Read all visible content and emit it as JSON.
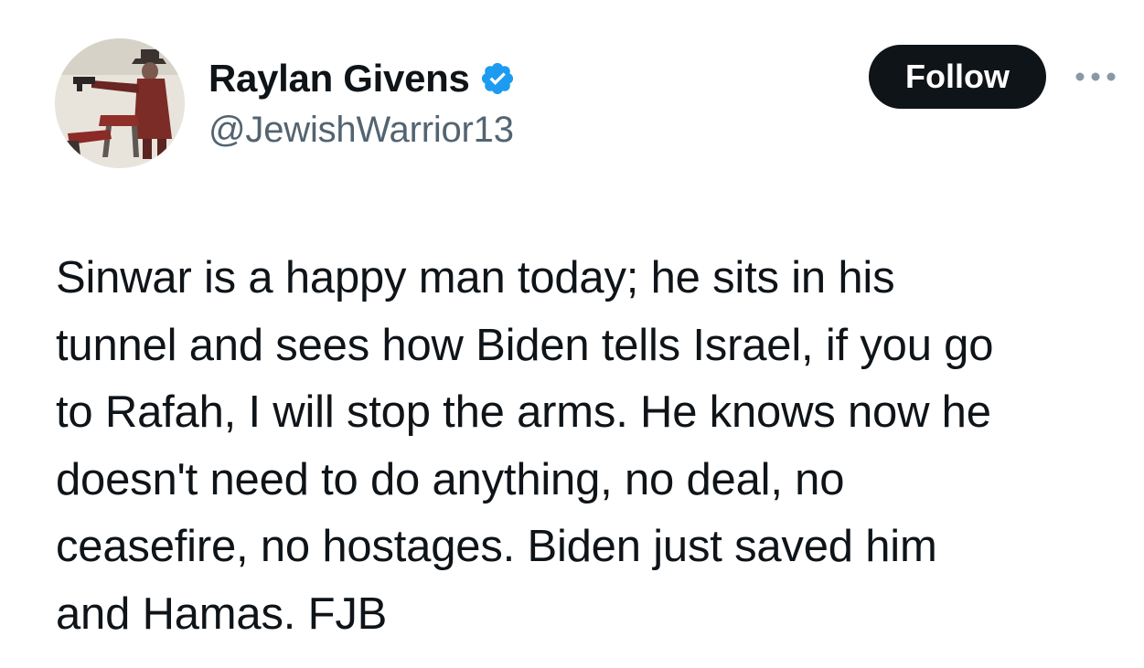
{
  "user": {
    "display_name": "Raylan Givens",
    "handle": "@JewishWarrior13",
    "verified": true,
    "avatar_icon": "western-gunman-avatar",
    "verified_icon": "verified-badge-icon"
  },
  "actions": {
    "follow_label": "Follow",
    "more_icon": "more-options-icon"
  },
  "tweet": {
    "text": "Sinwar is a happy man today; he sits in his\ntunnel and sees how Biden tells Israel, if you go\nto Rafah, I will stop the arms. He knows now he\ndoesn't need to do anything, no deal, no\nceasefire, no hostages. Biden just saved him\nand Hamas. FJB"
  },
  "colors": {
    "text": "#0f1419",
    "secondary": "#536471",
    "follow_bg": "#0f1419",
    "verified": "#1d9bf0"
  }
}
